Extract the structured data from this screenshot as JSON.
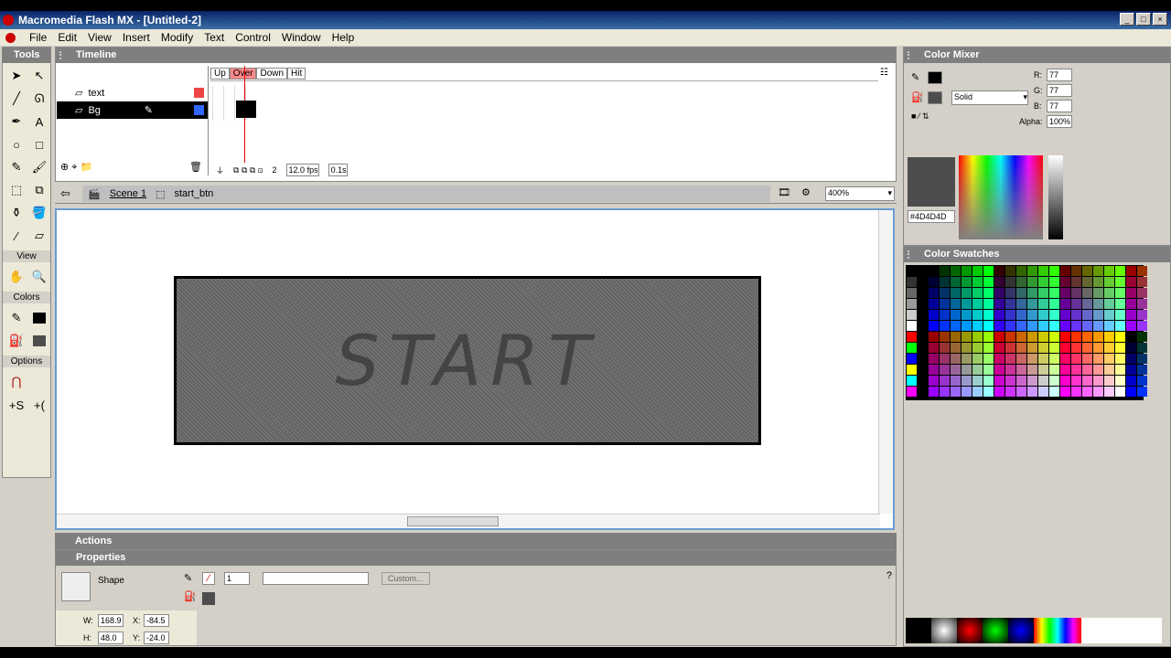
{
  "app": {
    "title": "Macromedia Flash MX - [Untitled-2]"
  },
  "menu": [
    "File",
    "Edit",
    "View",
    "Insert",
    "Modify",
    "Text",
    "Control",
    "Window",
    "Help"
  ],
  "tools": {
    "title": "Tools",
    "view_label": "View",
    "colors_label": "Colors",
    "options_label": "Options"
  },
  "timeline": {
    "title": "Timeline",
    "frame_labels": [
      "Up",
      "Over",
      "Down",
      "Hit"
    ],
    "layers": [
      {
        "name": "text"
      },
      {
        "name": "Bg"
      }
    ],
    "current_frame": "2",
    "fps": "12.0 fps",
    "time": "0.1s"
  },
  "scene": {
    "scene_name": "Scene 1",
    "symbol_name": "start_btn",
    "zoom": "400%"
  },
  "stage": {
    "button_text": "START"
  },
  "actions": {
    "title": "Actions"
  },
  "properties": {
    "title": "Properties",
    "type": "Shape",
    "stroke_size": "1",
    "stroke_style": "",
    "custom_label": "Custom...",
    "w_label": "W:",
    "w": "168.9",
    "x_label": "X:",
    "x": "-84.5",
    "h_label": "H:",
    "h": "48.0",
    "y_label": "Y:",
    "y": "-24.0"
  },
  "color_mixer": {
    "title": "Color Mixer",
    "fill_type": "Solid",
    "r_label": "R:",
    "r": "77",
    "g_label": "G:",
    "g": "77",
    "b_label": "B:",
    "b": "77",
    "alpha_label": "Alpha:",
    "alpha": "100%",
    "hex": "#4D4D4D",
    "color": "#4d4d4d"
  },
  "color_swatches": {
    "title": "Color Swatches"
  }
}
